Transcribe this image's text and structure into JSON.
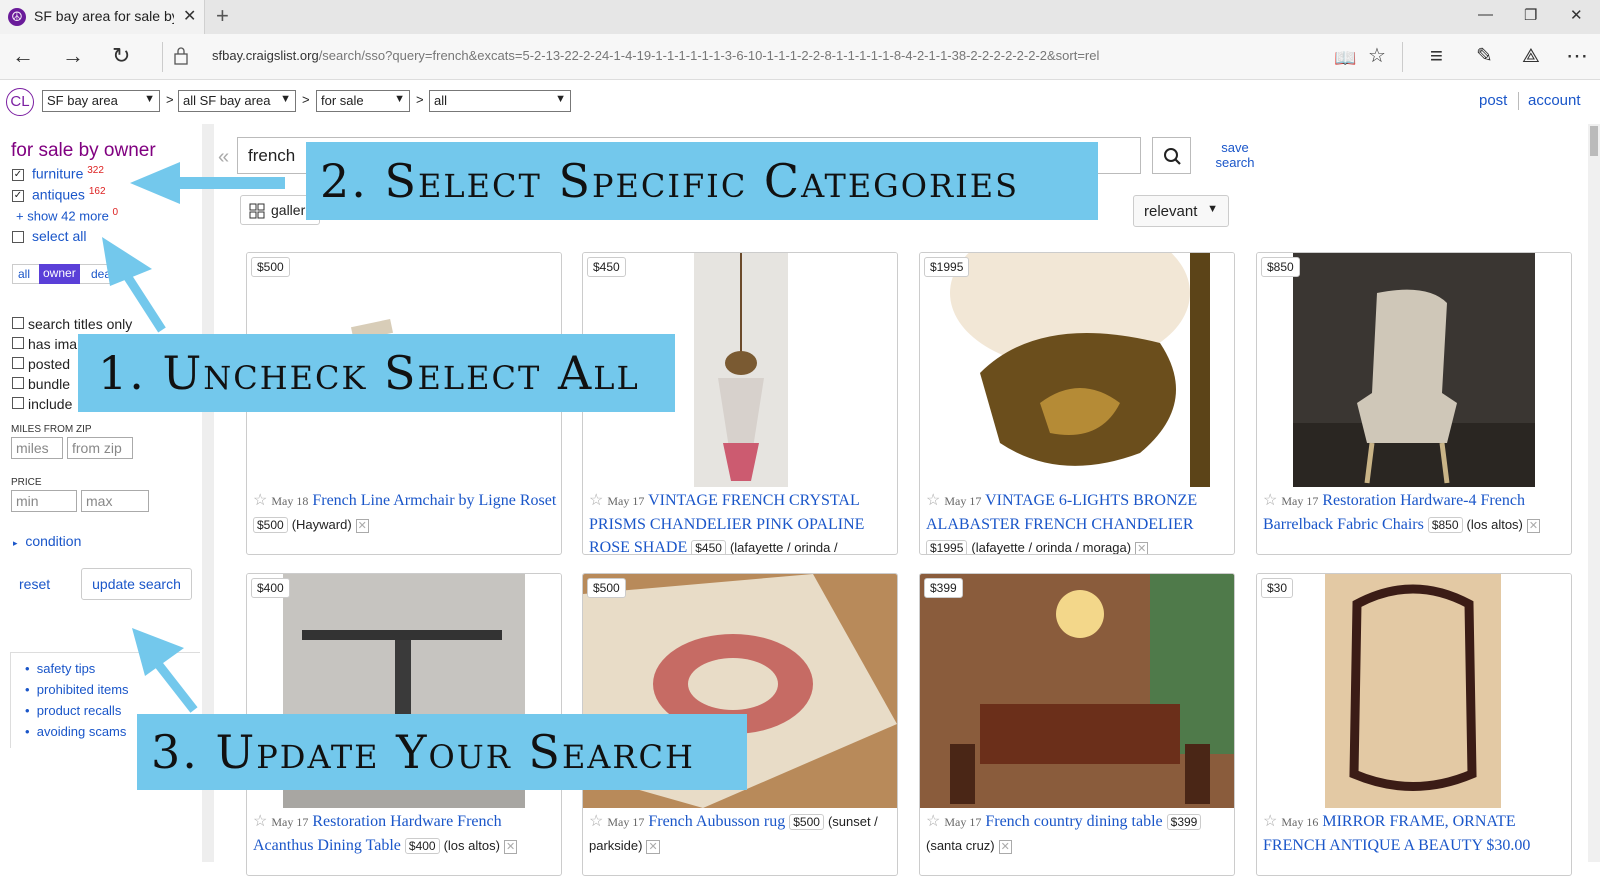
{
  "browser": {
    "tab_title": "SF bay area for sale by c",
    "url_domain": "sfbay.craigslist.org",
    "url_path": "/search/sso?query=french&excats=5-2-13-22-2-24-1-4-19-1-1-1-1-1-1-3-6-10-1-1-1-2-2-8-1-1-1-1-1-8-4-2-1-1-38-2-2-2-2-2-2-2&sort=rel"
  },
  "header": {
    "logo": "CL",
    "selects": [
      "SF bay area",
      "all SF bay area",
      "for sale",
      "all"
    ],
    "post": "post",
    "account": "account"
  },
  "sidebar": {
    "title": "for sale by owner",
    "cat_furniture": "furniture",
    "cat_furniture_count": "322",
    "cat_antiques": "antiques",
    "cat_antiques_count": "162",
    "show_more": "show 42 more",
    "show_more_count": "0",
    "select_all": "select all",
    "seg_all": "all",
    "seg_owner": "owner",
    "seg_dealer": "dea",
    "search_titles": "search titles only",
    "has_image": "has ima",
    "posted_today": "posted",
    "bundle": "bundle",
    "include": "include",
    "miles_label": "MILES FROM ZIP",
    "miles_ph": "miles",
    "zip_ph": "from zip",
    "price_label": "PRICE",
    "min_ph": "min",
    "max_ph": "max",
    "condition": "condition",
    "reset": "reset",
    "update": "update search",
    "links": [
      "safety tips",
      "prohibited items",
      "product recalls",
      "avoiding scams"
    ]
  },
  "search": {
    "query": "french",
    "save": "save search",
    "gallery": "galler",
    "sort": "relevant"
  },
  "listings": [
    {
      "price": "$500",
      "date": "May 18",
      "title": "French Line Armchair by Ligne Roset",
      "pill": "$500",
      "loc": "(Hayward)"
    },
    {
      "price": "$450",
      "date": "May 17",
      "title": "VINTAGE FRENCH CRYSTAL PRISMS CHANDELIER PINK OPALINE ROSE SHADE",
      "pill": "$450",
      "loc": "(lafayette / orinda /"
    },
    {
      "price": "$1995",
      "date": "May 17",
      "title": "VINTAGE 6-LIGHTS BRONZE ALABASTER FRENCH CHANDELIER",
      "pill": "$1995",
      "loc": "(lafayette / orinda / moraga)"
    },
    {
      "price": "$850",
      "date": "May 17",
      "title": "Restoration Hardware-4 French Barrelback Fabric Chairs",
      "pill": "$850",
      "loc": "(los altos)"
    },
    {
      "price": "$400",
      "date": "May 17",
      "title": "Restoration Hardware French Acanthus Dining Table",
      "pill": "$400",
      "loc": "(los altos)"
    },
    {
      "price": "$500",
      "date": "May 17",
      "title": "French Aubusson rug",
      "pill": "$500",
      "loc": "(sunset / parkside)"
    },
    {
      "price": "$399",
      "date": "May 17",
      "title": "French country dining table",
      "pill": "$399",
      "loc": "(santa cruz)"
    },
    {
      "price": "$30",
      "date": "May 16",
      "title": "MIRROR FRAME, ORNATE FRENCH ANTIQUE A BEAUTY $30.00",
      "pill": "",
      "loc": ""
    }
  ],
  "overlays": {
    "step1": "1. Uncheck Select All",
    "step2": "2. Select Specific Categories",
    "step3": "3. Update Your Search"
  },
  "colors": {
    "overlay": "#73c8ec",
    "link": "#1a56c9",
    "category": "#800080"
  }
}
